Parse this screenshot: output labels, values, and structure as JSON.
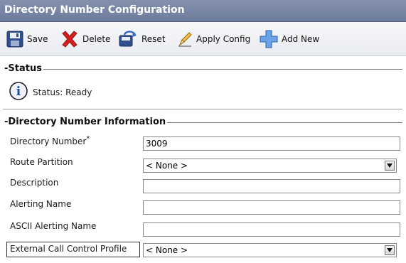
{
  "title": "Directory Number Configuration",
  "toolbar": {
    "save_label": "Save",
    "delete_label": "Delete",
    "reset_label": "Reset",
    "apply_label": "Apply Config",
    "add_label": "Add New"
  },
  "status": {
    "section_title": "Status",
    "text": "Status: Ready"
  },
  "dn_info": {
    "section_title": "Directory Number Information",
    "directory_number_label": "Directory Number",
    "required_marker": "*",
    "directory_number_value": "3009",
    "route_partition_label": "Route Partition",
    "route_partition_value": "< None >",
    "description_label": "Description",
    "description_value": "",
    "alerting_name_label": "Alerting Name",
    "alerting_name_value": "",
    "ascii_alerting_name_label": "ASCII Alerting Name",
    "ascii_alerting_name_value": "",
    "ext_call_control_label": "External Call Control Profile",
    "ext_call_control_value": "< None >"
  },
  "colors": {
    "title_bar": "#7584a3",
    "delete_red": "#d62020",
    "add_blue": "#3f7fd0",
    "info_blue": "#1f4fa8"
  },
  "icons": [
    "save-icon",
    "delete-icon",
    "reset-icon",
    "apply-config-icon",
    "add-new-icon",
    "info-icon",
    "dropdown-arrow-icon"
  ]
}
